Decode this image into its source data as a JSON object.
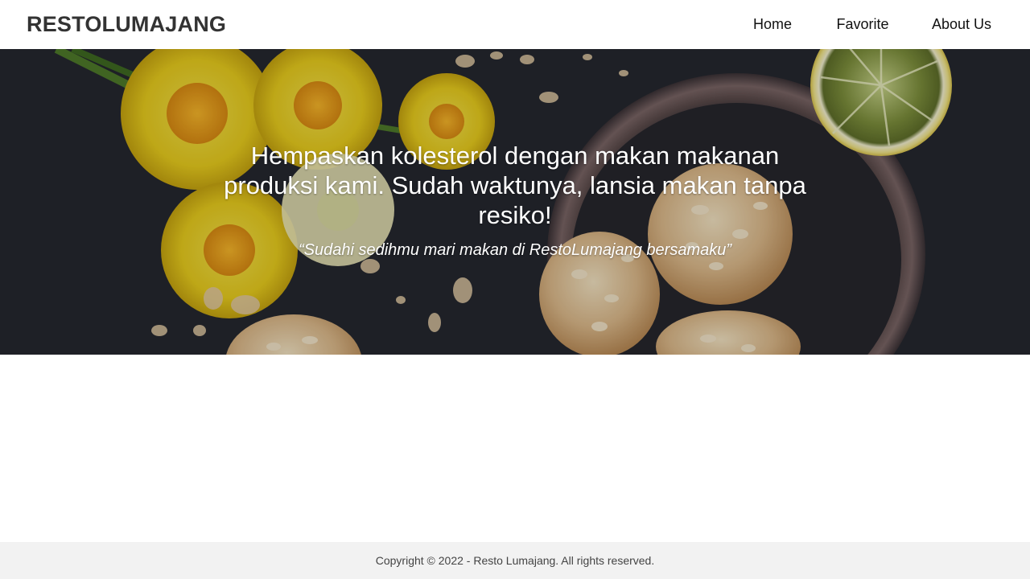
{
  "header": {
    "brand": "RESTOLUMAJANG",
    "nav": {
      "home": "Home",
      "favorite": "Favorite",
      "about": "About Us"
    }
  },
  "hero": {
    "title": "Hempaskan kolesterol dengan makan makanan produksi kami. Sudah waktunya, lansia makan tanpa resiko!",
    "tagline": "“Sudahi sedihmu mari makan di RestoLumajang bersamaku”"
  },
  "footer": {
    "copyright": "Copyright © 2022 - Resto Lumajang. All rights reserved."
  },
  "colors": {
    "header_bg": "#ffffff",
    "brand_text": "#333333",
    "hero_bg": "#1f2229",
    "hero_text": "#ffffff",
    "footer_bg": "#f2f2f2"
  }
}
